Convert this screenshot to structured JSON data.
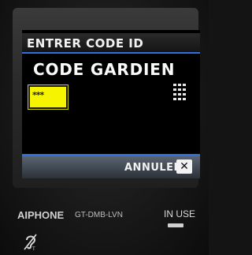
{
  "screen": {
    "title": "ENTRER CODE ID",
    "heading": "CODE GARDIEN",
    "code_value": "***",
    "keypad_icon": "keypad-grid-icon",
    "cancel_label": "ANNULER",
    "cancel_icon": "close-icon"
  },
  "device": {
    "brand": "AIPHONE",
    "model": "GT-DMB-LVN",
    "status_label": "IN USE",
    "hearing_icon": "hearing-loop-icon"
  },
  "colors": {
    "accent_line": "#2f6fe0",
    "code_field": "#f7f400",
    "screen_bg": "#000000"
  }
}
